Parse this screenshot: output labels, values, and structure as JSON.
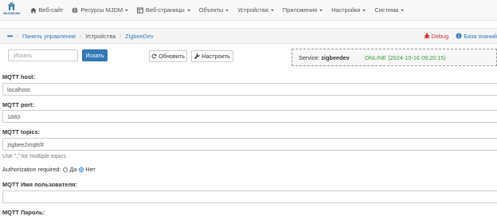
{
  "app": {
    "logo_text": "MAJORDOMO"
  },
  "nav": [
    {
      "label": "Веб-сайт",
      "icon": "home-icon",
      "caret": false
    },
    {
      "label": "Ресурсы MJDM",
      "icon": "globe-icon",
      "caret": true
    },
    {
      "label": "Веб-страницы",
      "icon": "pages-icon",
      "caret": true
    },
    {
      "label": "Объекты",
      "icon": "",
      "caret": true
    },
    {
      "label": "Устройства",
      "icon": "",
      "caret": true
    },
    {
      "label": "Приложения",
      "icon": "",
      "caret": true
    },
    {
      "label": "Настройки",
      "icon": "",
      "caret": true
    },
    {
      "label": "Система",
      "icon": "",
      "caret": true
    }
  ],
  "breadcrumb": {
    "menu": "•••",
    "items": [
      "Панель управления",
      "Устройства",
      "ZigbeeDev"
    ],
    "debug": "Debug",
    "knowledge_base": "База знаний"
  },
  "toolbar": {
    "search_placeholder": "Искать",
    "search_button": "Искать",
    "refresh": "Обновить",
    "configure": "Настроить"
  },
  "service": {
    "label": "Service:",
    "name": "zigbeedev",
    "status": "ONLINE (2024-10-16 09:20:15)",
    "status_color": "#3c9c3c"
  },
  "form": {
    "host_label": "MQTT host:",
    "host_value": "localhost",
    "port_label": "MQTT port:",
    "port_value": "1883",
    "topics_label": "MQTT topics:",
    "topics_value": "zigbee2mqtt/#",
    "topics_help": "Use \",\" for multiple topics",
    "auth_label": "Authorization required:",
    "auth_yes": "Да",
    "auth_no": "Нет",
    "auth_selected": "Нет",
    "username_label": "MQTT Имя пользователя:",
    "username_value": "",
    "password_label": "MQTT Пароль:"
  },
  "colors": {
    "accent": "#337ab7",
    "debug": "#c9302c"
  }
}
